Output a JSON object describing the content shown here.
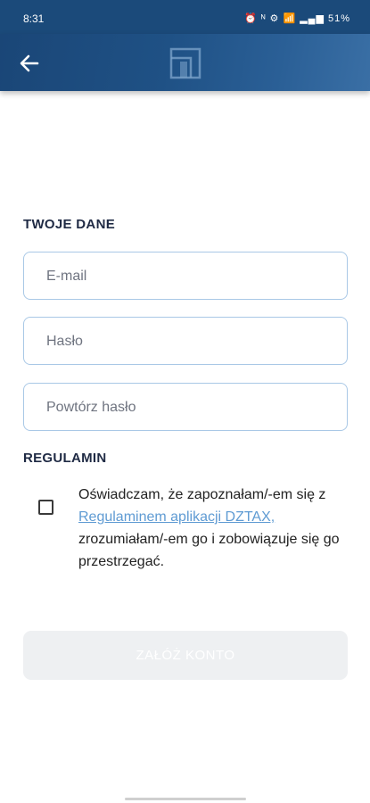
{
  "status_bar": {
    "time": "8:31",
    "indicators": "⏰ ᴺ ⚙ 📶 ▂▄▆ 51%"
  },
  "form": {
    "section_personal": "TWOJE DANE",
    "email_placeholder": "E-mail",
    "password_placeholder": "Hasło",
    "repeat_password_placeholder": "Powtórz hasło",
    "section_terms": "REGULAMIN",
    "consent_prefix": "Oświadczam, że zapoznałam/-em się z ",
    "consent_link": "Regulaminem aplikacji DZTAX,",
    "consent_suffix": " zrozumiałam/-em go i zobowiązuje się go przestrzegać.",
    "consent_checked": false,
    "submit_label": "ZAŁÓŻ KONTO",
    "submit_enabled": false
  },
  "colors": {
    "header": "#1f5185",
    "accent_link": "#5f9bd3",
    "field_border": "#a9c8e6",
    "disabled_button": "#eef0f2"
  },
  "icons": {
    "back": "arrow-left-icon",
    "logo": "app-logo-icon",
    "checkbox": "checkbox-empty-icon"
  }
}
